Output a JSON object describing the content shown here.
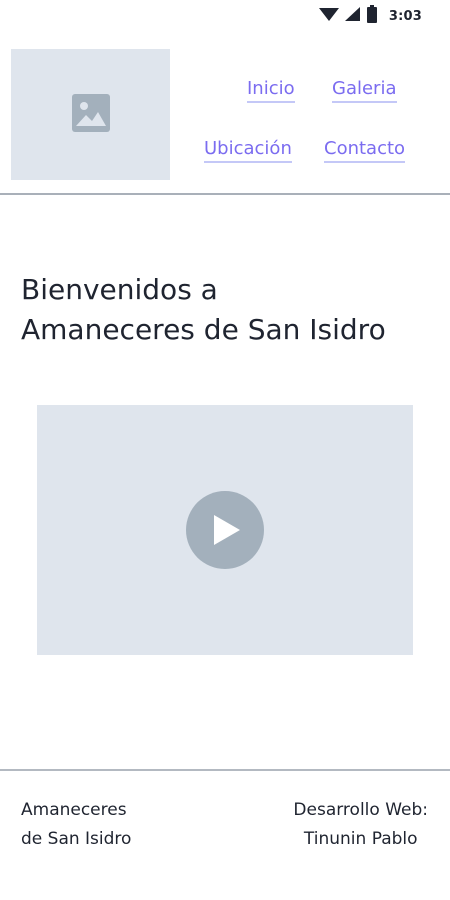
{
  "status_bar": {
    "time": "3:03",
    "icons": [
      "wifi-icon",
      "signal-icon",
      "battery-icon"
    ]
  },
  "header": {
    "logo_icon": "image-placeholder-icon",
    "nav": {
      "inicio": "Inicio",
      "galeria": "Galeria",
      "ubicacion": "Ubicación",
      "contacto": "Contacto"
    }
  },
  "main": {
    "title_line1": "Bienvenidos a",
    "title_line2": "Amaneceres de San Isidro",
    "video_icon": "play-icon"
  },
  "footer": {
    "left_line1": "Amaneceres",
    "left_line2": "de San Isidro",
    "right_line1": "Desarrollo Web:",
    "right_line2": "Tinunin Pablo"
  },
  "colors": {
    "link": "#7b6cf0",
    "placeholder_bg": "#dfe5ed",
    "placeholder_icon": "#a3b0bc",
    "divider": "#a9b0b9"
  }
}
